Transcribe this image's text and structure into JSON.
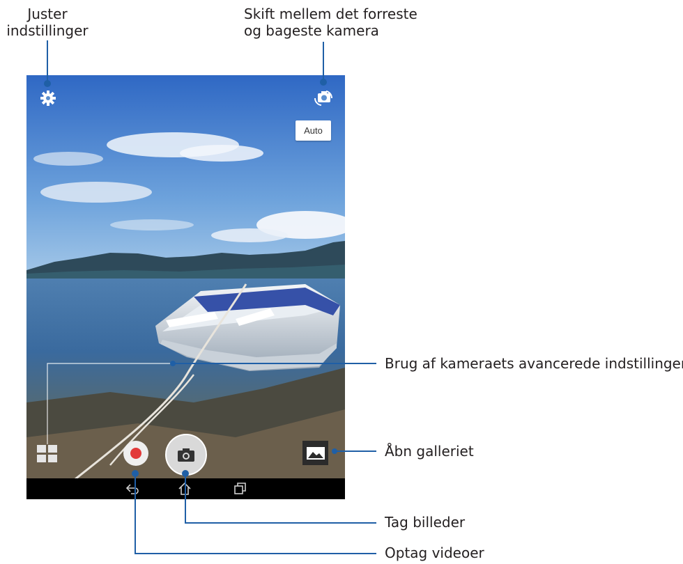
{
  "callouts": {
    "settings": [
      "Juster",
      "indstillinger"
    ],
    "switch_camera": [
      "Skift mellem det forreste",
      "og bageste kamera"
    ],
    "advanced": "Brug af kameraets avancerede indstillinger",
    "gallery": "Åbn galleriet",
    "take_photo": "Tag billeder",
    "record_video": "Optag videoer"
  },
  "camera": {
    "mode_label": "Auto",
    "top_icons": [
      "settings-gear-icon",
      "switch-camera-icon"
    ],
    "bottom_icons": [
      "camera-modes-icon",
      "record-video-icon",
      "shutter-camera-icon",
      "gallery-icon"
    ],
    "nav_icons": [
      "back-icon",
      "home-icon",
      "recent-apps-icon"
    ]
  },
  "colors": {
    "callout_line": "#1f5fa6",
    "record_dot": "#e23a3a",
    "navbar": "#000000"
  }
}
